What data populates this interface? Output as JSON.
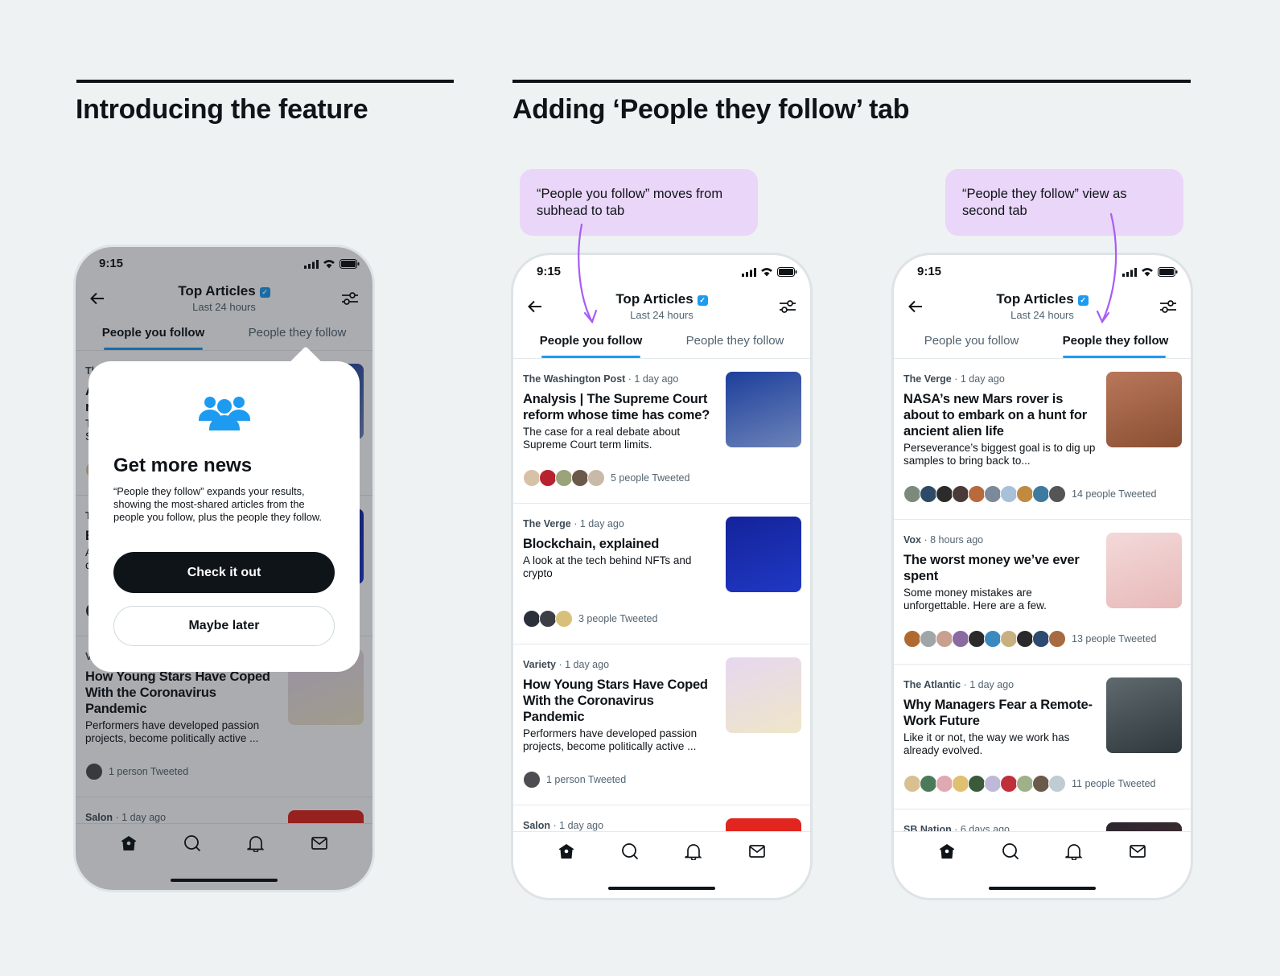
{
  "sections": [
    {
      "title": "Introducing the feature"
    },
    {
      "title": "Adding ‘People they follow’ tab"
    }
  ],
  "callouts": [
    {
      "text": "“People you follow” moves from subhead to tab"
    },
    {
      "text": "“People they follow” view as second tab"
    }
  ],
  "colors": {
    "accent": "#1d9bf0",
    "callout_bg": "#ead6f8",
    "arrow": "#a95cf5",
    "background": "#eef2f3"
  },
  "popup": {
    "icon": "people-group-icon",
    "heading": "Get more news",
    "body": "“People they follow” expands your results, showing the most-shared articles from the people you follow, plus the people they follow.",
    "primary_label": "Check it out",
    "secondary_label": "Maybe later"
  },
  "feeds": {
    "you_follow": [
      {
        "source": "The Washington Post",
        "time": "1 day ago",
        "title": "Analysis | The Supreme Court reform whose time has come?",
        "desc": "The case for a real debate about Supreme Court term limits.",
        "tweeted": "5 people Tweeted",
        "image": [
          "#1c3f9c",
          "#6d83b8"
        ],
        "avatars": [
          "#d7c2a8",
          "#b8222f",
          "#9aa37a",
          "#6b5a4a",
          "#c9b9a8"
        ]
      },
      {
        "source": "The Verge",
        "time": "1 day ago",
        "title": "Blockchain, explained",
        "desc": "A look at the tech behind NFTs and crypto",
        "tweeted": "3 people Tweeted",
        "image": [
          "#14239a",
          "#1f38c4"
        ],
        "avatars": [
          "#2a2f3a",
          "#3b3e45",
          "#d9c07a"
        ]
      },
      {
        "source": "Variety",
        "time": "1 day ago",
        "title": "How Young Stars Have Coped With the Coronavirus Pandemic",
        "desc": "Performers have developed passion projects, become politically active ...",
        "tweeted": "1 person Tweeted",
        "image": [
          "#e6d7f0",
          "#efe6c8"
        ],
        "avatars": [
          "#4e4e52"
        ]
      },
      {
        "source": "Salon",
        "time": "1 day ago",
        "title": "",
        "desc": "",
        "tweeted": "",
        "image": [
          "#e0261e",
          "#e0261e"
        ],
        "avatars": []
      }
    ],
    "they_follow": [
      {
        "source": "The Verge",
        "time": "1 day ago",
        "title": "NASA’s new Mars rover is about to embark on a hunt for ancient alien life",
        "desc": "Perseverance’s biggest goal is to dig up samples to bring back to...",
        "tweeted": "14 people Tweeted",
        "image": [
          "#b9775a",
          "#8a4f33"
        ],
        "avatars": [
          "#7c8a7c",
          "#2f4a66",
          "#2b2b2b",
          "#4a3a3a",
          "#b86a3c",
          "#7a8a9a",
          "#a8c0d8",
          "#c08a40",
          "#3c7aa0",
          "#555"
        ]
      },
      {
        "source": "Vox",
        "time": "8 hours ago",
        "title": "The worst money we’ve ever spent",
        "desc": "Some money mistakes are unforgettable. Here are a few.",
        "tweeted": "13 people Tweeted",
        "image": [
          "#f3d9d9",
          "#e8b9b9"
        ],
        "avatars": [
          "#b06a30",
          "#a0a6a8",
          "#c9a090",
          "#8a6aa0",
          "#2b2b2b",
          "#3a8ac0",
          "#c9b080",
          "#2a2a2a",
          "#2d4a70",
          "#a86a40"
        ]
      },
      {
        "source": "The Atlantic",
        "time": "1 day ago",
        "title": "Why Managers Fear a Remote-Work Future",
        "desc": "Like it or not, the way we work has already evolved.",
        "tweeted": "11 people Tweeted",
        "image": [
          "#5f6a6e",
          "#2f383c"
        ],
        "avatars": [
          "#d8c090",
          "#4a7a5a",
          "#e0a8b0",
          "#e0c070",
          "#3a5a3a",
          "#c0b8d8",
          "#c0303a",
          "#a0b088",
          "#6a5a4a",
          "#c0ccd4"
        ]
      },
      {
        "source": "SB Nation",
        "time": "6 days ago",
        "title": "",
        "desc": "",
        "tweeted": "",
        "image": [
          "#2a2530",
          "#5a3530"
        ],
        "avatars": []
      }
    ]
  },
  "phones": [
    {
      "time": "9:15",
      "title": "Top Articles",
      "subtitle": "Last 24 hours",
      "tabs": [
        "People you follow",
        "People they follow"
      ],
      "active_tab": 0,
      "feed": "you_follow",
      "popup": true
    },
    {
      "time": "9:15",
      "title": "Top Articles",
      "subtitle": "Last 24 hours",
      "tabs": [
        "People you follow",
        "People they follow"
      ],
      "active_tab": 0,
      "feed": "you_follow",
      "popup": false
    },
    {
      "time": "9:15",
      "title": "Top Articles",
      "subtitle": "Last 24 hours",
      "tabs": [
        "People you follow",
        "People they follow"
      ],
      "active_tab": 1,
      "feed": "they_follow",
      "popup": false
    }
  ]
}
